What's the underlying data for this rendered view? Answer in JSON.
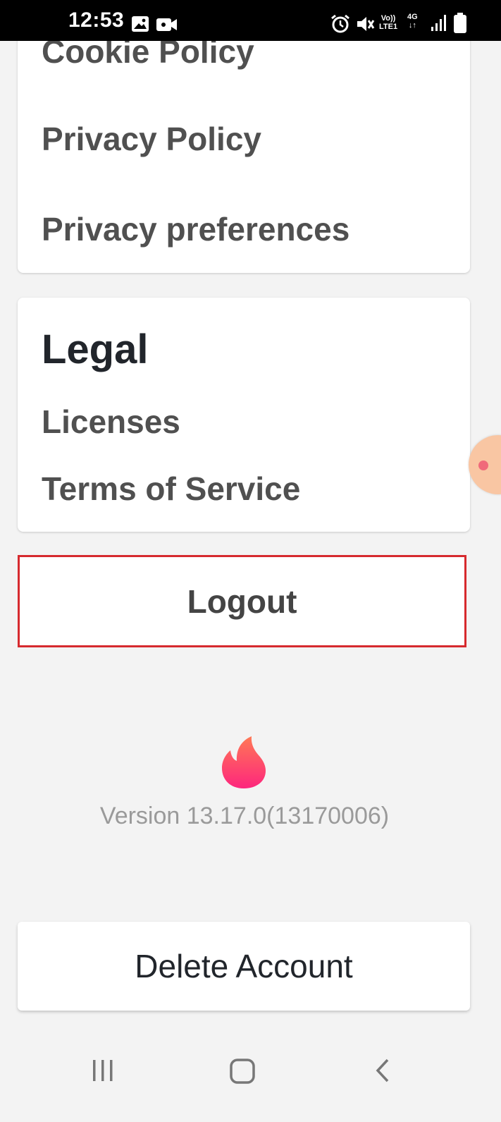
{
  "status_bar": {
    "time": "12:53",
    "network_vo": "Vo))",
    "network_lte": "LTE1",
    "network_gen": "4G",
    "icons": [
      "gallery-icon",
      "video-camera-icon",
      "alarm-icon",
      "mute-icon",
      "signal-icon",
      "battery-icon"
    ]
  },
  "privacy_card": {
    "items": [
      "Cookie Policy",
      "Privacy Policy",
      "Privacy preferences"
    ]
  },
  "legal_card": {
    "title": "Legal",
    "items": [
      "Licenses",
      "Terms of Service"
    ]
  },
  "logout": {
    "label": "Logout",
    "highlight_color": "#d62a2e"
  },
  "app_info": {
    "logo": "flame-icon",
    "version": "Version 13.17.0(13170006)"
  },
  "delete_account": {
    "label": "Delete Account"
  },
  "nav_bar": {
    "icons": [
      "recent-apps-icon",
      "home-icon",
      "back-icon"
    ]
  },
  "colors": {
    "brand_flame_top": "#ff7855",
    "brand_flame_bottom": "#fd267d"
  }
}
